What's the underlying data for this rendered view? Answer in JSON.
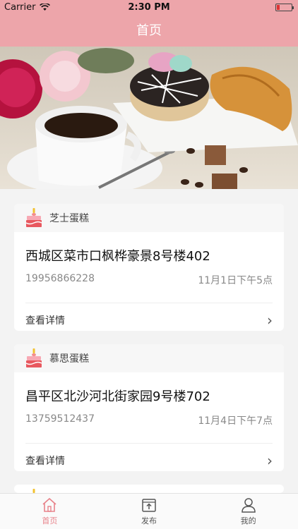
{
  "status_bar": {
    "carrier": "Carrier",
    "time": "2:30 PM"
  },
  "nav": {
    "title": "首页"
  },
  "hero": {
    "icon": "cake-photo-banner"
  },
  "orders": [
    {
      "shop": "芝士蛋糕",
      "address": "西城区菜市口枫桦豪景8号楼402",
      "phone": "19956866228",
      "delivery_time": "11月1日下午5点",
      "detail_label": "查看详情"
    },
    {
      "shop": "慕思蛋糕",
      "address": "昌平区北沙河北街家园9号楼702",
      "phone": "13759512437",
      "delivery_time": "11月4日下午7点",
      "detail_label": "查看详情"
    }
  ],
  "tabs": [
    {
      "label": "首页",
      "icon": "home-icon",
      "active": true
    },
    {
      "label": "发布",
      "icon": "publish-icon",
      "active": false
    },
    {
      "label": "我的",
      "icon": "profile-icon",
      "active": false
    }
  ],
  "colors": {
    "accent": "#eda5aa",
    "active_tab": "#e8838b"
  }
}
